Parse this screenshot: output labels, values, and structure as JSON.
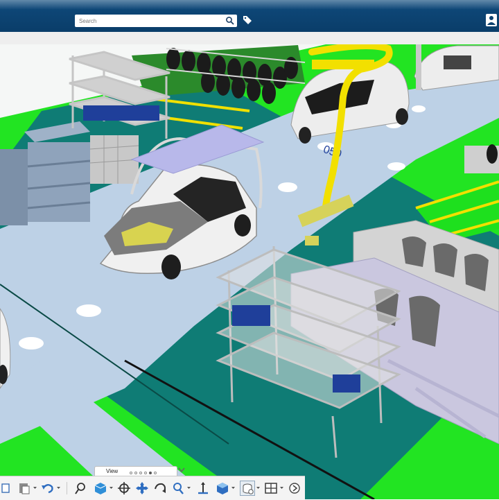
{
  "header": {
    "search": {
      "placeholder": "Search"
    }
  },
  "toolbar": {
    "view_tab_label": "View",
    "view_pages": [
      false,
      false,
      false,
      false,
      true,
      false
    ],
    "buttons": [
      "cut-icon",
      "paste-icon",
      "undo-icon",
      "zoom-area-icon",
      "view-cube-icon",
      "center-icon",
      "pan-icon",
      "rotate-icon",
      "zoom-icon",
      "measure-icon",
      "render-style-icon",
      "material-icon",
      "layout-icon",
      "next-icon"
    ]
  },
  "colors": {
    "header": "#0c416f",
    "floor_green": "#1ee01e",
    "aisle_teal": "#0e7a73",
    "walkway_blue": "#b8cde4",
    "robot_yellow": "#f2e000"
  }
}
